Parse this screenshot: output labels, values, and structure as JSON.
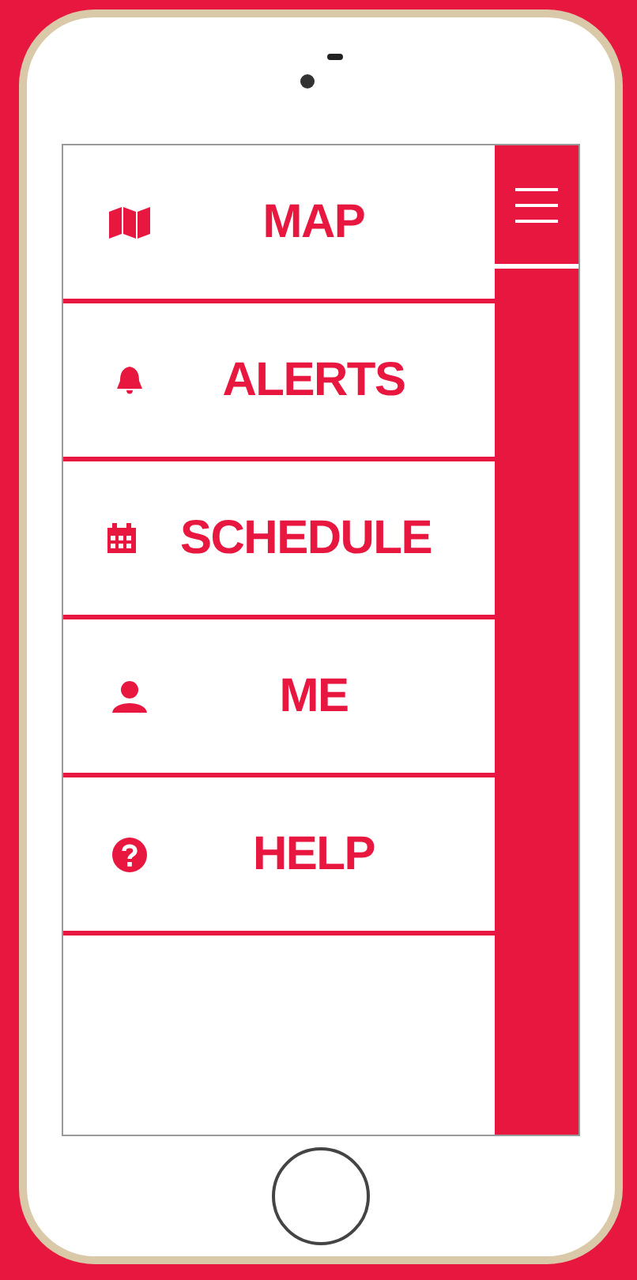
{
  "menu": {
    "items": [
      {
        "kind": "map",
        "label": "MAP"
      },
      {
        "kind": "bell",
        "label": "ALERTS"
      },
      {
        "kind": "calendar",
        "label": "SCHEDULE"
      },
      {
        "kind": "person",
        "label": "ME"
      },
      {
        "kind": "help",
        "label": "HELP"
      }
    ]
  }
}
